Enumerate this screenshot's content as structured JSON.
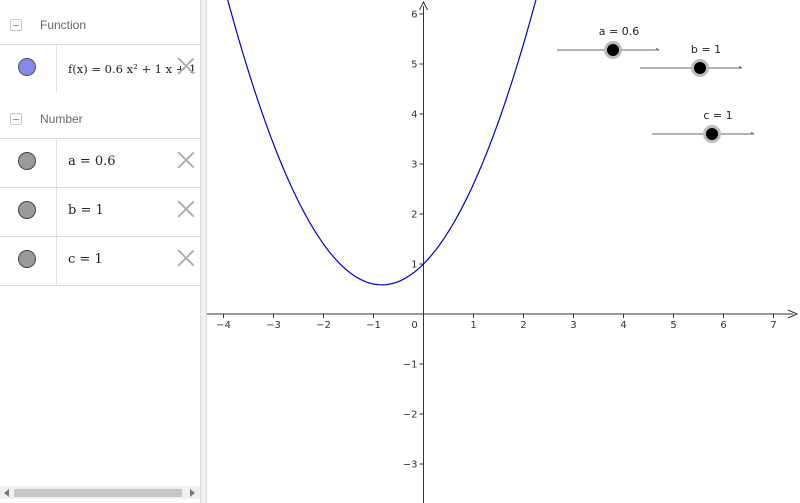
{
  "algebra": {
    "groups": [
      {
        "title": "Function"
      },
      {
        "title": "Number"
      }
    ],
    "function": {
      "expression": "f(x) = 0.6 x² + 1 x + 1"
    },
    "numbers": [
      {
        "label": "a = 0.6"
      },
      {
        "label": "b = 1"
      },
      {
        "label": "c = 1"
      }
    ]
  },
  "graphics": {
    "axes": {
      "x_ticks": [
        "−4",
        "−3",
        "−2",
        "−1",
        "0",
        "1",
        "2",
        "3",
        "4",
        "5",
        "6",
        "7"
      ],
      "y_ticks": [
        "6",
        "5",
        "4",
        "3",
        "2",
        "1",
        "−1",
        "−2",
        "−3"
      ]
    },
    "sliders": [
      {
        "label": "a = 0.6",
        "value": 0.6
      },
      {
        "label": "b = 1",
        "value": 1
      },
      {
        "label": "c = 1",
        "value": 1
      }
    ],
    "curve_color": "#0000cc"
  }
}
